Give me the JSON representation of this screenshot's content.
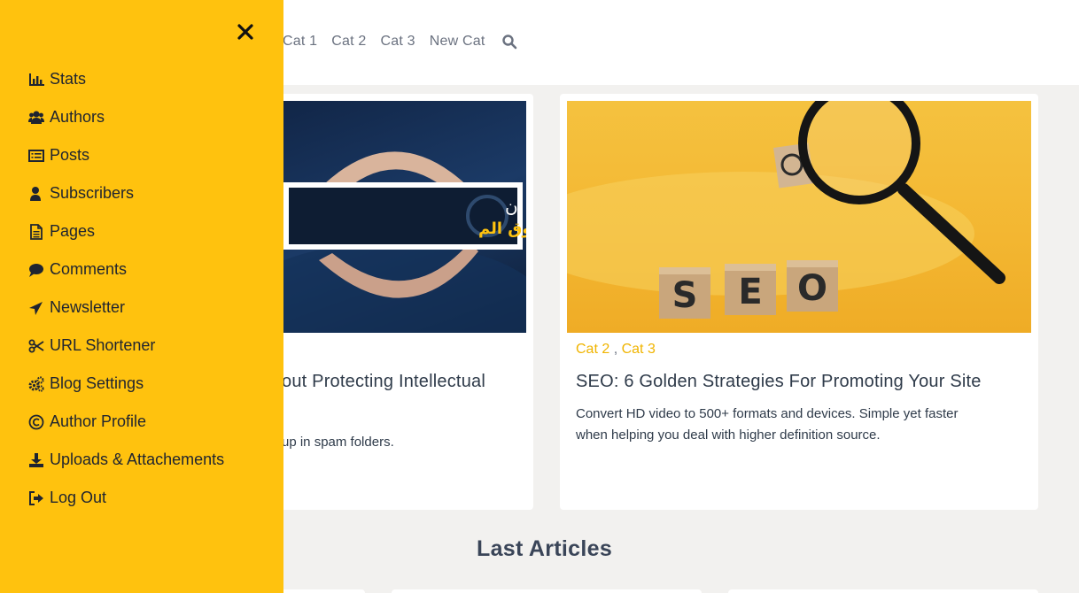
{
  "nav": {
    "items": [
      "Cat 1",
      "Cat 2",
      "Cat 3",
      "New Cat"
    ],
    "search_icon": "search-icon"
  },
  "posts": [
    {
      "image_text_line1": "كل ما ينبغي أن",
      "image_text_line2": "حماية حقوق الم",
      "title": "out Protecting Intellectual",
      "excerpt": "up in spam folders."
    },
    {
      "categories": [
        "Cat 2",
        "Cat 3"
      ],
      "category_separator": " , ",
      "image_blocks": [
        "S",
        "E",
        "O"
      ],
      "title": "SEO: 6 Golden Strategies For Promoting Your Site",
      "excerpt_line1": "Convert HD video to 500+ formats and devices. Simple yet faster",
      "excerpt_line2": "when helping you deal with higher definition source."
    }
  ],
  "section": {
    "last_articles": "Last Articles"
  },
  "sidebar": {
    "close_icon": "close-icon",
    "items": [
      {
        "label": "Stats",
        "icon": "bar-chart-icon"
      },
      {
        "label": "Authors",
        "icon": "users-icon"
      },
      {
        "label": "Posts",
        "icon": "posts-list-icon"
      },
      {
        "label": "Subscribers",
        "icon": "user-icon"
      },
      {
        "label": "Pages",
        "icon": "document-icon"
      },
      {
        "label": "Comments",
        "icon": "comment-icon"
      },
      {
        "label": "Newsletter",
        "icon": "paper-plane-icon"
      },
      {
        "label": "URL Shortener",
        "icon": "scissors-icon"
      },
      {
        "label": "Blog Settings",
        "icon": "gears-icon"
      },
      {
        "label": "Author Profile",
        "icon": "copyright-icon"
      },
      {
        "label": "Uploads & Attachements",
        "icon": "download-icon"
      },
      {
        "label": "Log Out",
        "icon": "logout-icon"
      }
    ]
  },
  "colors": {
    "accent": "#ffc20e",
    "category_link": "#f0b400",
    "background": "#f2f1ef"
  }
}
